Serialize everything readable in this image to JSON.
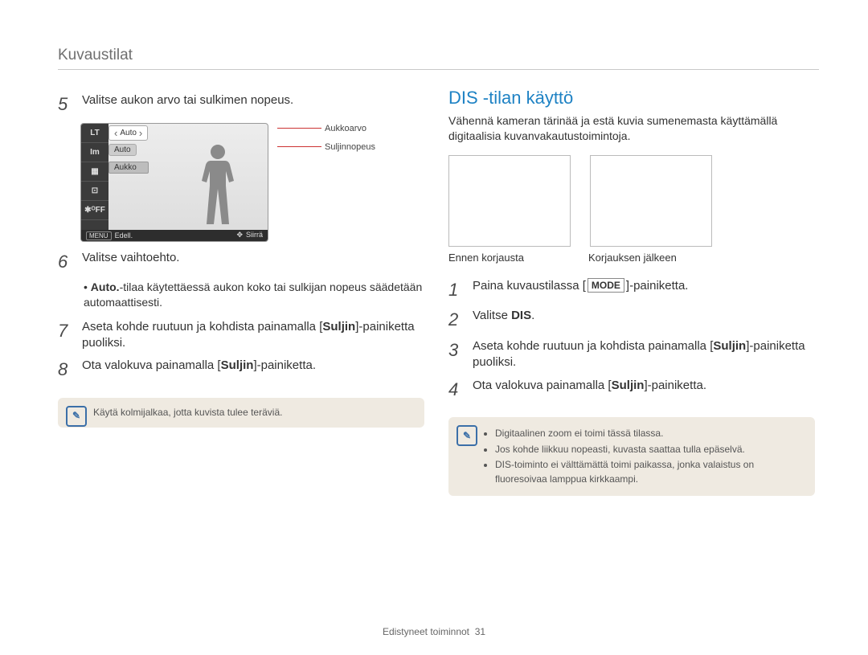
{
  "section_title": "Kuvaustilat",
  "left": {
    "steps": {
      "s5": {
        "num": "5",
        "text": "Valitse aukon arvo tai sulkimen nopeus."
      },
      "s6": {
        "num": "6",
        "text": "Valitse vaihtoehto.",
        "bullet_prefix": "Auto.",
        "bullet_rest": "-tilaa käytettäessä aukon koko tai sulkijan nopeus säädetään automaattisesti."
      },
      "s7": {
        "num": "7",
        "pre": "Aseta kohde ruutuun ja kohdista painamalla [",
        "b": "Suljin",
        "post": "]-painiketta puoliksi."
      },
      "s8": {
        "num": "8",
        "pre": "Ota valokuva painamalla [",
        "b": "Suljin",
        "post": "]-painiketta."
      }
    },
    "lcd": {
      "icons": [
        "LT",
        "Im",
        "▦",
        "⊡",
        "✱ᴼFF"
      ],
      "auto": "Auto",
      "aukko": "Aukko",
      "menu": "MENU",
      "edell": "Edell.",
      "siirra": "Siirrä",
      "callout_aperture": "Aukkoarvo",
      "callout_shutter": "Suljinnopeus"
    },
    "tip": "Käytä kolmijalkaa, jotta kuvista tulee teräviä."
  },
  "right": {
    "title": "DIS -tilan käyttö",
    "desc": "Vähennä kameran tärinää ja estä kuvia sumenemasta käyttämällä digitaalisia kuvanvakautustoimintoja.",
    "thumb_before": "Ennen korjausta",
    "thumb_after": "Korjauksen jälkeen",
    "steps": {
      "s1": {
        "num": "1",
        "pre": "Paina kuvaustilassa [",
        "mode": "MODE",
        "post": "]-painiketta."
      },
      "s2": {
        "num": "2",
        "pre": "Valitse ",
        "b": "DIS",
        "post": "."
      },
      "s3": {
        "num": "3",
        "pre": "Aseta kohde ruutuun ja kohdista painamalla [",
        "b": "Suljin",
        "post": "]-painiketta puoliksi."
      },
      "s4": {
        "num": "4",
        "pre": "Ota valokuva painamalla [",
        "b": "Suljin",
        "post": "]-painiketta."
      }
    },
    "tips": [
      "Digitaalinen zoom ei toimi tässä tilassa.",
      "Jos kohde liikkuu nopeasti, kuvasta saattaa tulla epäselvä.",
      "DIS-toiminto ei välttämättä toimi paikassa, jonka valaistus on fluoresoivaa lamppua kirkkaampi."
    ]
  },
  "footer": {
    "label": "Edistyneet toiminnot",
    "page": "31"
  }
}
